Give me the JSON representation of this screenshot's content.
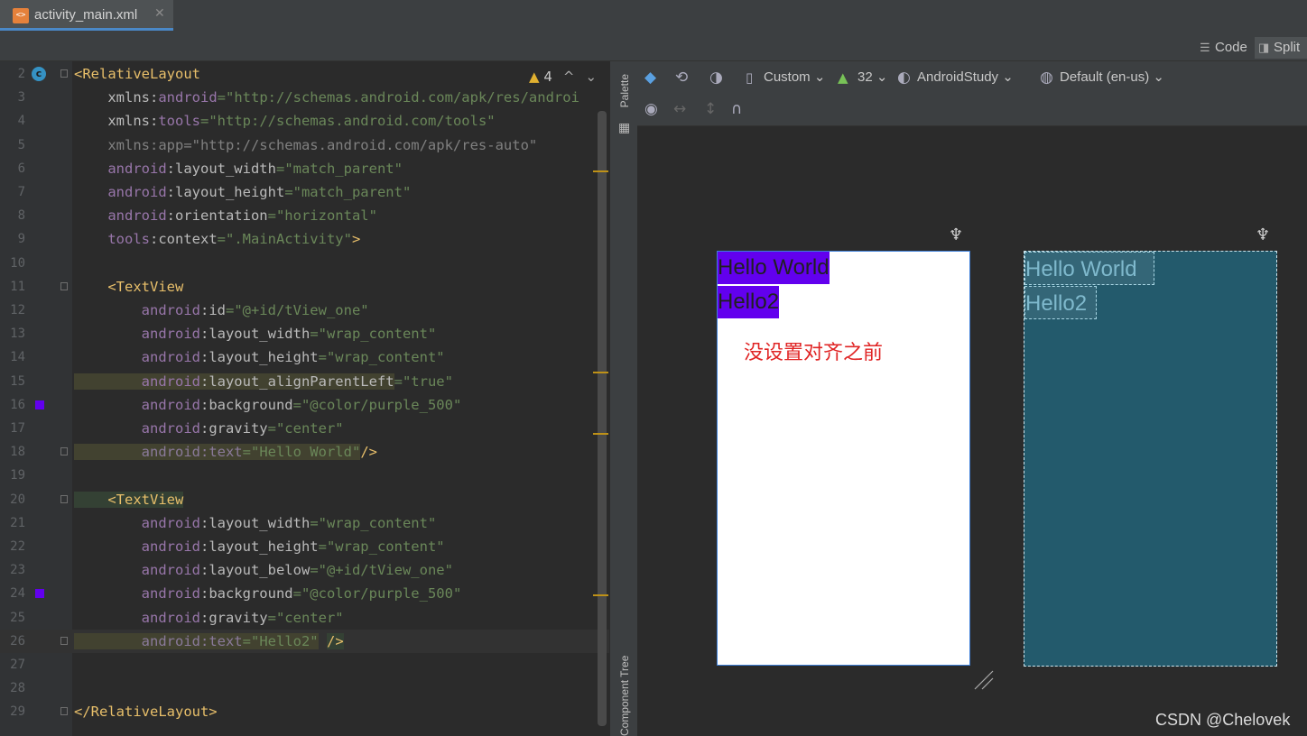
{
  "tab": {
    "filename": "activity_main.xml",
    "close": "✕",
    "file_icon": "xml-file-icon"
  },
  "view_modes": {
    "code": "Code",
    "split": "Split",
    "active": "split"
  },
  "editor": {
    "warnings": "4",
    "lines": [
      {
        "n": "2",
        "segs": [
          [
            "tag",
            "<RelativeLayout"
          ]
        ]
      },
      {
        "n": "3",
        "segs": [
          [
            "attr",
            "    xmlns:"
          ],
          [
            "ns",
            "android"
          ],
          [
            "val",
            "=\"http://schemas.android.com/apk/res/androi"
          ]
        ]
      },
      {
        "n": "4",
        "segs": [
          [
            "attr",
            "    xmlns:"
          ],
          [
            "ns",
            "tools"
          ],
          [
            "val",
            "=\"http://schemas.android.com/tools\""
          ]
        ]
      },
      {
        "n": "5",
        "segs": [
          [
            "dim",
            "    xmlns:app=\"http://schemas.android.com/apk/res-auto\""
          ]
        ]
      },
      {
        "n": "6",
        "segs": [
          [
            "ns",
            "    android"
          ],
          [
            "attr",
            ":layout_width"
          ],
          [
            "val",
            "=\"match_parent\""
          ]
        ]
      },
      {
        "n": "7",
        "segs": [
          [
            "ns",
            "    android"
          ],
          [
            "attr",
            ":layout_height"
          ],
          [
            "val",
            "=\"match_parent\""
          ]
        ]
      },
      {
        "n": "8",
        "segs": [
          [
            "ns",
            "    android"
          ],
          [
            "attr",
            ":orientation"
          ],
          [
            "val",
            "=\"horizontal\""
          ]
        ]
      },
      {
        "n": "9",
        "segs": [
          [
            "ns",
            "    tools"
          ],
          [
            "attr",
            ":context"
          ],
          [
            "val",
            "=\".MainActivity\""
          ],
          [
            "tag",
            ">"
          ]
        ]
      },
      {
        "n": "10",
        "segs": []
      },
      {
        "n": "11",
        "segs": [
          [
            "tag",
            "    <TextView"
          ]
        ]
      },
      {
        "n": "12",
        "segs": [
          [
            "ns",
            "        android"
          ],
          [
            "attr",
            ":id"
          ],
          [
            "val",
            "=\"@+id/tView_one\""
          ]
        ]
      },
      {
        "n": "13",
        "segs": [
          [
            "ns",
            "        android"
          ],
          [
            "attr",
            ":layout_width"
          ],
          [
            "val",
            "=\"wrap_content\""
          ]
        ]
      },
      {
        "n": "14",
        "segs": [
          [
            "ns",
            "        android"
          ],
          [
            "attr",
            ":layout_height"
          ],
          [
            "val",
            "=\"wrap_content\""
          ]
        ]
      },
      {
        "n": "15",
        "segs": [
          [
            "ns",
            "        android"
          ],
          [
            "attr",
            ":layout_alignParentLeft"
          ],
          [
            "val",
            "=\"true\""
          ]
        ]
      },
      {
        "n": "16",
        "segs": [
          [
            "ns",
            "        android"
          ],
          [
            "attr",
            ":background"
          ],
          [
            "val",
            "=\"@color/purple_500\""
          ]
        ]
      },
      {
        "n": "17",
        "segs": [
          [
            "ns",
            "        android"
          ],
          [
            "attr",
            ":gravity"
          ],
          [
            "val",
            "=\"center\""
          ]
        ]
      },
      {
        "n": "18",
        "segs": [
          [
            "attrdim",
            "        android"
          ],
          [
            "attrdim",
            ":text"
          ],
          [
            "val",
            "=\"Hello World\""
          ],
          [
            "tag",
            "/>"
          ]
        ]
      },
      {
        "n": "19",
        "segs": []
      },
      {
        "n": "20",
        "segs": [
          [
            "tag",
            "    <TextView"
          ]
        ]
      },
      {
        "n": "21",
        "segs": [
          [
            "ns",
            "        android"
          ],
          [
            "attr",
            ":layout_width"
          ],
          [
            "val",
            "=\"wrap_content\""
          ]
        ]
      },
      {
        "n": "22",
        "segs": [
          [
            "ns",
            "        android"
          ],
          [
            "attr",
            ":layout_height"
          ],
          [
            "val",
            "=\"wrap_content\""
          ]
        ]
      },
      {
        "n": "23",
        "segs": [
          [
            "ns",
            "        android"
          ],
          [
            "attr",
            ":layout_below"
          ],
          [
            "val",
            "=\"@+id/tView_one\""
          ]
        ]
      },
      {
        "n": "24",
        "segs": [
          [
            "ns",
            "        android"
          ],
          [
            "attr",
            ":background"
          ],
          [
            "val",
            "=\"@color/purple_500\""
          ]
        ]
      },
      {
        "n": "25",
        "segs": [
          [
            "ns",
            "        android"
          ],
          [
            "attr",
            ":gravity"
          ],
          [
            "val",
            "=\"center\""
          ]
        ]
      },
      {
        "n": "26",
        "segs": [
          [
            "attrdim",
            "        android"
          ],
          [
            "attrdim",
            ":text"
          ],
          [
            "val",
            "=\"Hello2\""
          ],
          [
            "attr",
            " "
          ],
          [
            "tag",
            "/>"
          ]
        ]
      },
      {
        "n": "27",
        "segs": []
      },
      {
        "n": "28",
        "segs": []
      },
      {
        "n": "29",
        "segs": [
          [
            "tag",
            "</RelativeLayout>"
          ]
        ]
      }
    ]
  },
  "side_strip": {
    "palette": "Palette",
    "component_tree": "Component Tree"
  },
  "design_toolbar": {
    "device": "Custom",
    "api": "32",
    "theme": "AndroidStudy",
    "locale": "Default (en-us)"
  },
  "preview": {
    "text_one": "Hello World",
    "text_two": "Hello2",
    "note": "没设置对齐之前",
    "accent_color": "#6200ee"
  },
  "watermark": "CSDN @Chelovek"
}
